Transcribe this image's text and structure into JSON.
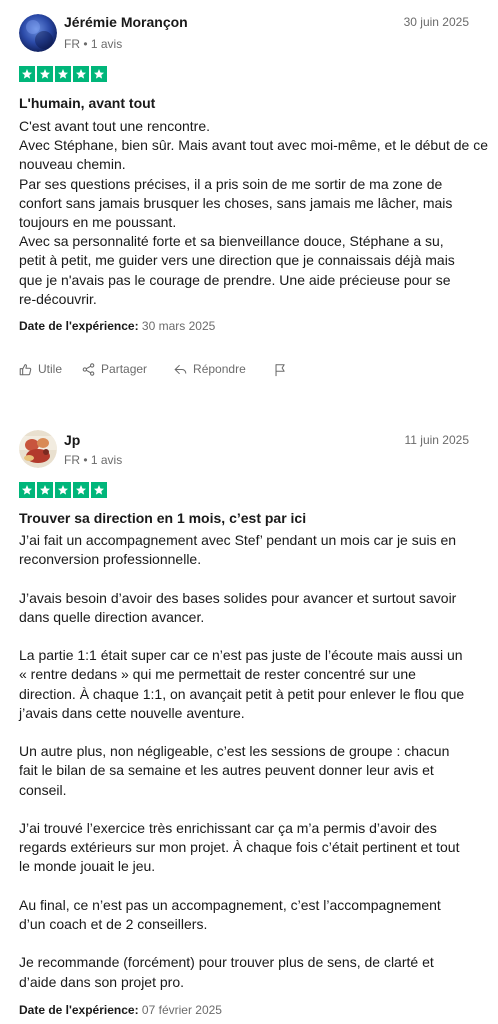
{
  "reviews": [
    {
      "author": "Jérémie Morançon",
      "meta": "FR • 1 avis",
      "date": "30 juin 2025",
      "rating": 5,
      "title": "L'humain, avant tout",
      "lines": [
        "C'est avant tout une rencontre.",
        "Avec Stéphane, bien sûr. Mais avant tout avec moi-même, et le début de ce",
        "nouveau chemin.",
        "Par ses questions précises, il a pris soin de me sortir de ma zone de",
        "confort sans jamais brusquer les choses, sans jamais me lâcher, mais",
        "toujours en me poussant.",
        "Avec sa personnalité forte et sa bienveillance douce, Stéphane a su,",
        "petit à petit, me guider vers une direction que je connaissais déjà mais",
        "que je n'avais pas le courage de prendre. Une aide précieuse pour se",
        "re-découvrir."
      ],
      "experience_label": "Date de l'expérience:",
      "experience_date": "30 mars 2025",
      "actions": {
        "useful": "Utile",
        "share": "Partager",
        "reply": "Répondre"
      }
    },
    {
      "author": "Jp",
      "meta": "FR • 1 avis",
      "date": "11 juin 2025",
      "rating": 5,
      "title": "Trouver sa direction en 1 mois, c’est par ici",
      "lines": [
        "J’ai fait un accompagnement avec Stef’ pendant un mois car je suis en",
        "reconversion professionnelle.",
        "",
        "J’avais besoin d’avoir des bases solides pour avancer et surtout savoir",
        "dans quelle direction avancer.",
        "",
        "La partie 1:1 était super car ce n’est pas juste de l’écoute mais aussi un",
        "« rentre dedans » qui me permettait de rester concentré sur une",
        "direction. À chaque 1:1, on avançait petit à petit pour enlever le flou que",
        "j’avais dans cette nouvelle aventure.",
        "",
        "Un autre plus, non négligeable, c’est les sessions de groupe : chacun",
        "fait le bilan de sa semaine et les autres peuvent donner leur avis et",
        "conseil.",
        "",
        "J’ai trouvé l’exercice très enrichissant car ça m’a permis d’avoir des",
        "regards extérieurs sur mon projet. À chaque fois c’était pertinent et tout",
        "le monde jouait le jeu.",
        "",
        "Au final, ce n’est pas un accompagnement, c’est l’accompagnement",
        "d’un coach et de 2 conseillers.",
        "",
        "Je recommande (forcément) pour trouver plus de sens, de clarté et",
        "d’aide dans son projet pro."
      ],
      "experience_label": "Date de l'expérience:",
      "experience_date": "07 février 2025"
    }
  ],
  "colors": {
    "star_green": "#00b67a",
    "muted_text": "#6b6b6b",
    "text": "#191919"
  },
  "icons": [
    "star-icon",
    "thumbs-up-icon",
    "share-icon",
    "reply-icon",
    "flag-icon"
  ]
}
